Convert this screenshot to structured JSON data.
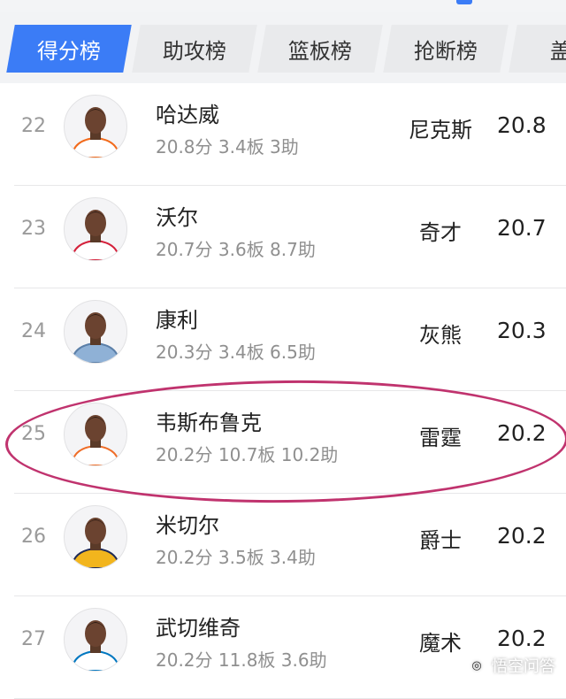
{
  "tabs": [
    {
      "label": "得分榜",
      "active": true
    },
    {
      "label": "助攻榜",
      "active": false
    },
    {
      "label": "篮板榜",
      "active": false
    },
    {
      "label": "抢断榜",
      "active": false
    },
    {
      "label": "盖帽",
      "active": false
    }
  ],
  "players": [
    {
      "rank": "22",
      "name": "哈达威",
      "stats": "20.8分 3.4板 3助",
      "team": "尼克斯",
      "points": "20.8",
      "jersey_color": "#ffffff",
      "jersey_accent": "#f26a1b"
    },
    {
      "rank": "23",
      "name": "沃尔",
      "stats": "20.7分 3.6板 8.7助",
      "team": "奇才",
      "points": "20.7",
      "jersey_color": "#ffffff",
      "jersey_accent": "#d4213b"
    },
    {
      "rank": "24",
      "name": "康利",
      "stats": "20.3分 3.4板 6.5助",
      "team": "灰熊",
      "points": "20.3",
      "jersey_color": "#8fb1d6",
      "jersey_accent": "#5b7fa8"
    },
    {
      "rank": "25",
      "name": "韦斯布鲁克",
      "stats": "20.2分 10.7板 10.2助",
      "team": "雷霆",
      "points": "20.2",
      "jersey_color": "#ffffff",
      "jersey_accent": "#ef6d28"
    },
    {
      "rank": "26",
      "name": "米切尔",
      "stats": "20.2分 3.5板 3.4助",
      "team": "爵士",
      "points": "20.2",
      "jersey_color": "#f2b51d",
      "jersey_accent": "#1f2a56"
    },
    {
      "rank": "27",
      "name": "武切维奇",
      "stats": "20.2分 11.8板 3.6助",
      "team": "魔术",
      "points": "20.2",
      "jersey_color": "#ffffff",
      "jersey_accent": "#0077c0"
    }
  ],
  "watermark": {
    "text": "悟空问答",
    "icon": "wukong-logo-icon"
  },
  "colors": {
    "accent": "#3b7cf6",
    "highlight_circle": "#c0336e"
  }
}
